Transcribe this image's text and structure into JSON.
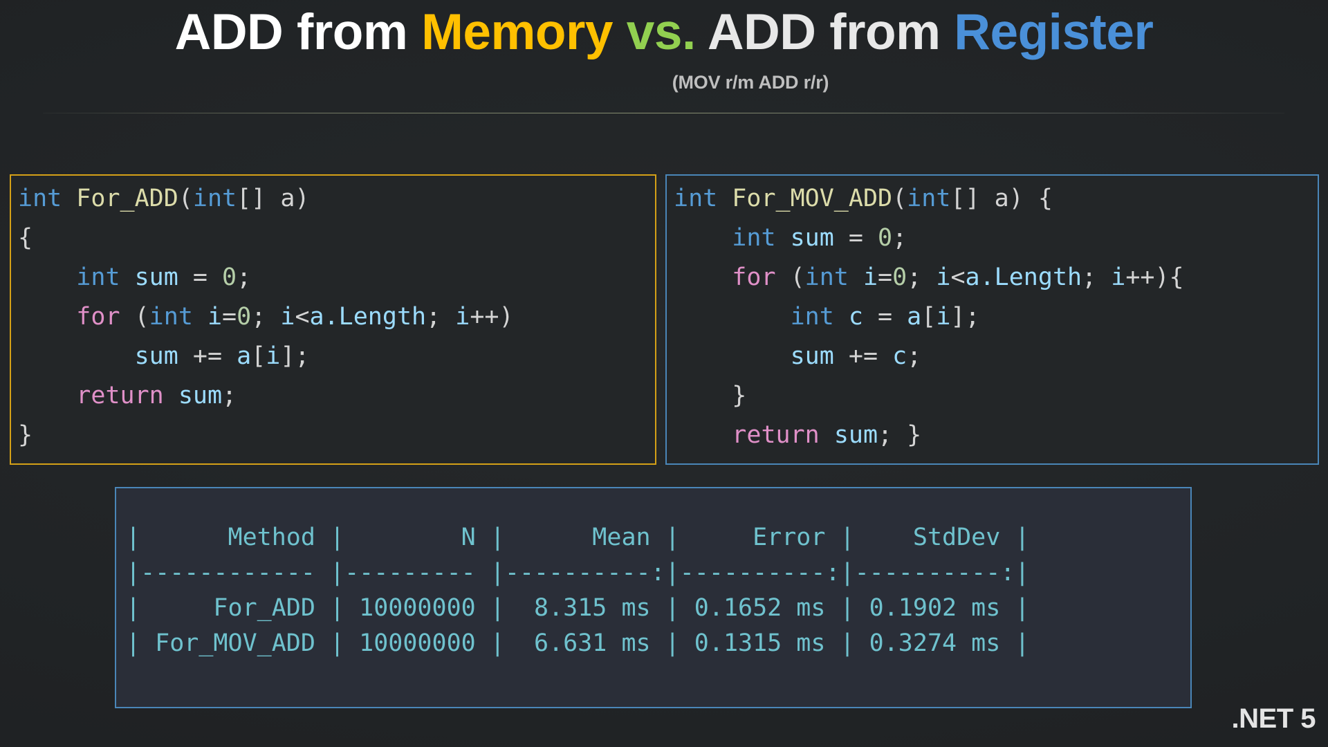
{
  "title": {
    "segments": [
      {
        "text": "ADD from ",
        "color": "#ffffff"
      },
      {
        "text": "Memory ",
        "color": "#ffc000"
      },
      {
        "text": "vs. ",
        "color": "#92d050"
      },
      {
        "text": "ADD from ",
        "color": "#e8e8e8"
      },
      {
        "text": "Register",
        "color": "#4a90d9"
      }
    ],
    "subtitle": "(MOV r/m ADD r/r)"
  },
  "code_left": {
    "border_color": "#d4a017",
    "lines": [
      [
        {
          "t": "int",
          "c": "kw"
        },
        {
          "t": " ",
          "c": "punc"
        },
        {
          "t": "For_ADD",
          "c": "fn"
        },
        {
          "t": "(",
          "c": "punc"
        },
        {
          "t": "int",
          "c": "kw"
        },
        {
          "t": "[] a)",
          "c": "punc"
        }
      ],
      [
        {
          "t": "{",
          "c": "punc"
        }
      ],
      [
        {
          "t": "    ",
          "c": "punc"
        },
        {
          "t": "int",
          "c": "kw"
        },
        {
          "t": " ",
          "c": "punc"
        },
        {
          "t": "sum",
          "c": "var"
        },
        {
          "t": " = ",
          "c": "punc"
        },
        {
          "t": "0",
          "c": "num"
        },
        {
          "t": ";",
          "c": "punc"
        }
      ],
      [
        {
          "t": "    ",
          "c": "punc"
        },
        {
          "t": "for",
          "c": "ctrl"
        },
        {
          "t": " (",
          "c": "punc"
        },
        {
          "t": "int",
          "c": "kw"
        },
        {
          "t": " ",
          "c": "punc"
        },
        {
          "t": "i",
          "c": "var"
        },
        {
          "t": "=",
          "c": "punc"
        },
        {
          "t": "0",
          "c": "num"
        },
        {
          "t": "; ",
          "c": "punc"
        },
        {
          "t": "i",
          "c": "var"
        },
        {
          "t": "<",
          "c": "punc"
        },
        {
          "t": "a.Length",
          "c": "var"
        },
        {
          "t": "; ",
          "c": "punc"
        },
        {
          "t": "i",
          "c": "var"
        },
        {
          "t": "++)",
          "c": "punc"
        }
      ],
      [
        {
          "t": "        ",
          "c": "punc"
        },
        {
          "t": "sum",
          "c": "var"
        },
        {
          "t": " += ",
          "c": "punc"
        },
        {
          "t": "a",
          "c": "var"
        },
        {
          "t": "[",
          "c": "punc"
        },
        {
          "t": "i",
          "c": "var"
        },
        {
          "t": "];",
          "c": "punc"
        }
      ],
      [
        {
          "t": "    ",
          "c": "punc"
        },
        {
          "t": "return",
          "c": "ctrl"
        },
        {
          "t": " ",
          "c": "punc"
        },
        {
          "t": "sum",
          "c": "var"
        },
        {
          "t": ";",
          "c": "punc"
        }
      ],
      [
        {
          "t": "}",
          "c": "punc"
        }
      ]
    ]
  },
  "code_right": {
    "border_color": "#4a86b8",
    "lines": [
      [
        {
          "t": "int",
          "c": "kw"
        },
        {
          "t": " ",
          "c": "punc"
        },
        {
          "t": "For_MOV_ADD",
          "c": "fn"
        },
        {
          "t": "(",
          "c": "punc"
        },
        {
          "t": "int",
          "c": "kw"
        },
        {
          "t": "[] a) {",
          "c": "punc"
        }
      ],
      [
        {
          "t": "    ",
          "c": "punc"
        },
        {
          "t": "int",
          "c": "kw"
        },
        {
          "t": " ",
          "c": "punc"
        },
        {
          "t": "sum",
          "c": "var"
        },
        {
          "t": " = ",
          "c": "punc"
        },
        {
          "t": "0",
          "c": "num"
        },
        {
          "t": ";",
          "c": "punc"
        }
      ],
      [
        {
          "t": "    ",
          "c": "punc"
        },
        {
          "t": "for",
          "c": "ctrl"
        },
        {
          "t": " (",
          "c": "punc"
        },
        {
          "t": "int",
          "c": "kw"
        },
        {
          "t": " ",
          "c": "punc"
        },
        {
          "t": "i",
          "c": "var"
        },
        {
          "t": "=",
          "c": "punc"
        },
        {
          "t": "0",
          "c": "num"
        },
        {
          "t": "; ",
          "c": "punc"
        },
        {
          "t": "i",
          "c": "var"
        },
        {
          "t": "<",
          "c": "punc"
        },
        {
          "t": "a.Length",
          "c": "var"
        },
        {
          "t": "; ",
          "c": "punc"
        },
        {
          "t": "i",
          "c": "var"
        },
        {
          "t": "++){",
          "c": "punc"
        }
      ],
      [
        {
          "t": "        ",
          "c": "punc"
        },
        {
          "t": "int",
          "c": "kw"
        },
        {
          "t": " ",
          "c": "punc"
        },
        {
          "t": "c",
          "c": "var"
        },
        {
          "t": " = ",
          "c": "punc"
        },
        {
          "t": "a",
          "c": "var"
        },
        {
          "t": "[",
          "c": "punc"
        },
        {
          "t": "i",
          "c": "var"
        },
        {
          "t": "];",
          "c": "punc"
        }
      ],
      [
        {
          "t": "        ",
          "c": "punc"
        },
        {
          "t": "sum",
          "c": "var"
        },
        {
          "t": " += ",
          "c": "punc"
        },
        {
          "t": "c",
          "c": "var"
        },
        {
          "t": ";",
          "c": "punc"
        }
      ],
      [
        {
          "t": "    ",
          "c": "punc"
        },
        {
          "t": "}",
          "c": "punc"
        }
      ],
      [
        {
          "t": "    ",
          "c": "punc"
        },
        {
          "t": "return",
          "c": "ctrl"
        },
        {
          "t": " ",
          "c": "punc"
        },
        {
          "t": "sum",
          "c": "var"
        },
        {
          "t": "; }",
          "c": "punc"
        }
      ]
    ]
  },
  "benchmark": {
    "text_color": "#6fc2ce",
    "border_color": "#4a86b8",
    "headers": [
      "Method",
      "N",
      "Mean",
      "Error",
      "StdDev"
    ],
    "rows": [
      {
        "Method": "For_ADD",
        "N": "10000000",
        "Mean": "8.315 ms",
        "Error": "0.1652 ms",
        "StdDev": "0.1902 ms"
      },
      {
        "Method": "For_MOV_ADD",
        "N": "10000000",
        "Mean": "6.631 ms",
        "Error": "0.1315 ms",
        "StdDev": "0.3274 ms"
      }
    ],
    "raw_lines": [
      "|      Method |        N |      Mean |     Error |    StdDev |",
      "|------------ |--------- |----------:|----------:|----------:|",
      "|     For_ADD | 10000000 |  8.315 ms | 0.1652 ms | 0.1902 ms |",
      "| For_MOV_ADD | 10000000 |  6.631 ms | 0.1315 ms | 0.3274 ms |"
    ]
  },
  "footer": {
    "runtime_badge": ".NET 5"
  }
}
